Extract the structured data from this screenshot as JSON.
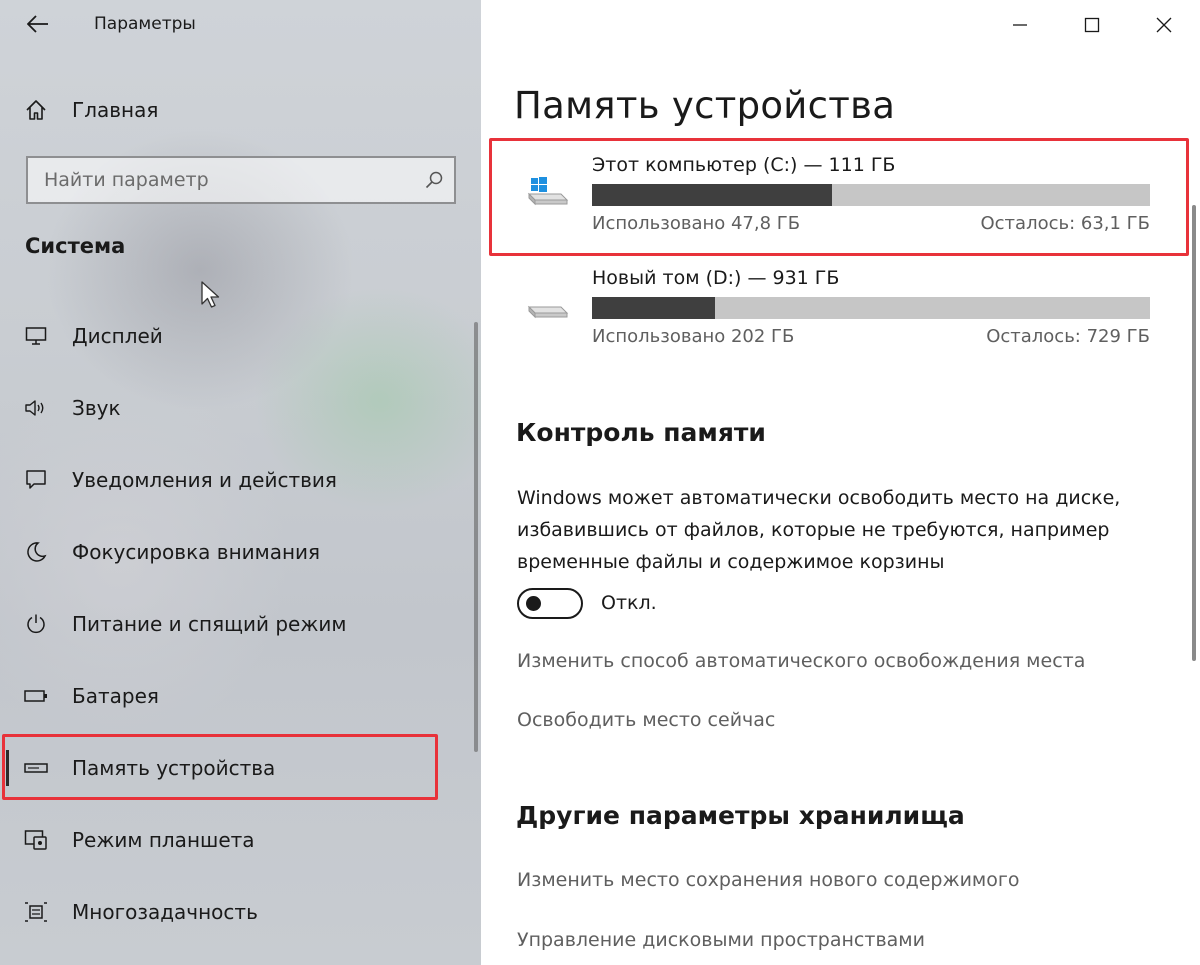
{
  "app": {
    "title": "Параметры"
  },
  "sidebar": {
    "home_label": "Главная",
    "search": {
      "placeholder": "Найти параметр",
      "value": ""
    },
    "section_title": "Система",
    "items": [
      {
        "label": "Дисплей",
        "icon": "display-icon"
      },
      {
        "label": "Звук",
        "icon": "speaker-icon"
      },
      {
        "label": "Уведомления и действия",
        "icon": "notification-icon"
      },
      {
        "label": "Фокусировка внимания",
        "icon": "moon-icon"
      },
      {
        "label": "Питание и спящий режим",
        "icon": "power-icon"
      },
      {
        "label": "Батарея",
        "icon": "battery-icon"
      },
      {
        "label": "Память устройства",
        "icon": "storage-icon",
        "selected": true
      },
      {
        "label": "Режим планшета",
        "icon": "tablet-mode-icon"
      },
      {
        "label": "Многозадачность",
        "icon": "multitasking-icon"
      }
    ]
  },
  "main": {
    "page_title": "Память устройства",
    "drives": [
      {
        "name": "Этот компьютер (C:) — 111 ГБ",
        "used": "Использовано 47,8 ГБ",
        "free": "Осталось: 63,1 ГБ",
        "used_fraction": 0.43,
        "icon": "windows-drive-icon"
      },
      {
        "name": "Новый том (D:) — 931 ГБ",
        "used": "Использовано 202 ГБ",
        "free": "Осталось: 729 ГБ",
        "used_fraction": 0.22,
        "icon": "drive-icon"
      }
    ],
    "storage_sense": {
      "title": "Контроль памяти",
      "description": "Windows может автоматически освободить место на диске, избавившись от файлов, которые не требуются, например временные файлы и содержимое корзины",
      "toggle_label": "Откл.",
      "toggle_on": false,
      "links": [
        "Изменить способ автоматического освобождения места",
        "Освободить место сейчас"
      ]
    },
    "other": {
      "title": "Другие параметры хранилища",
      "links": [
        "Изменить место сохранения нового содержимого",
        "Управление дисковыми пространствами"
      ]
    }
  },
  "colors": {
    "highlight": "#e8323a",
    "bar_fill": "#3f3f3f",
    "bar_track": "#c6c6c6"
  }
}
